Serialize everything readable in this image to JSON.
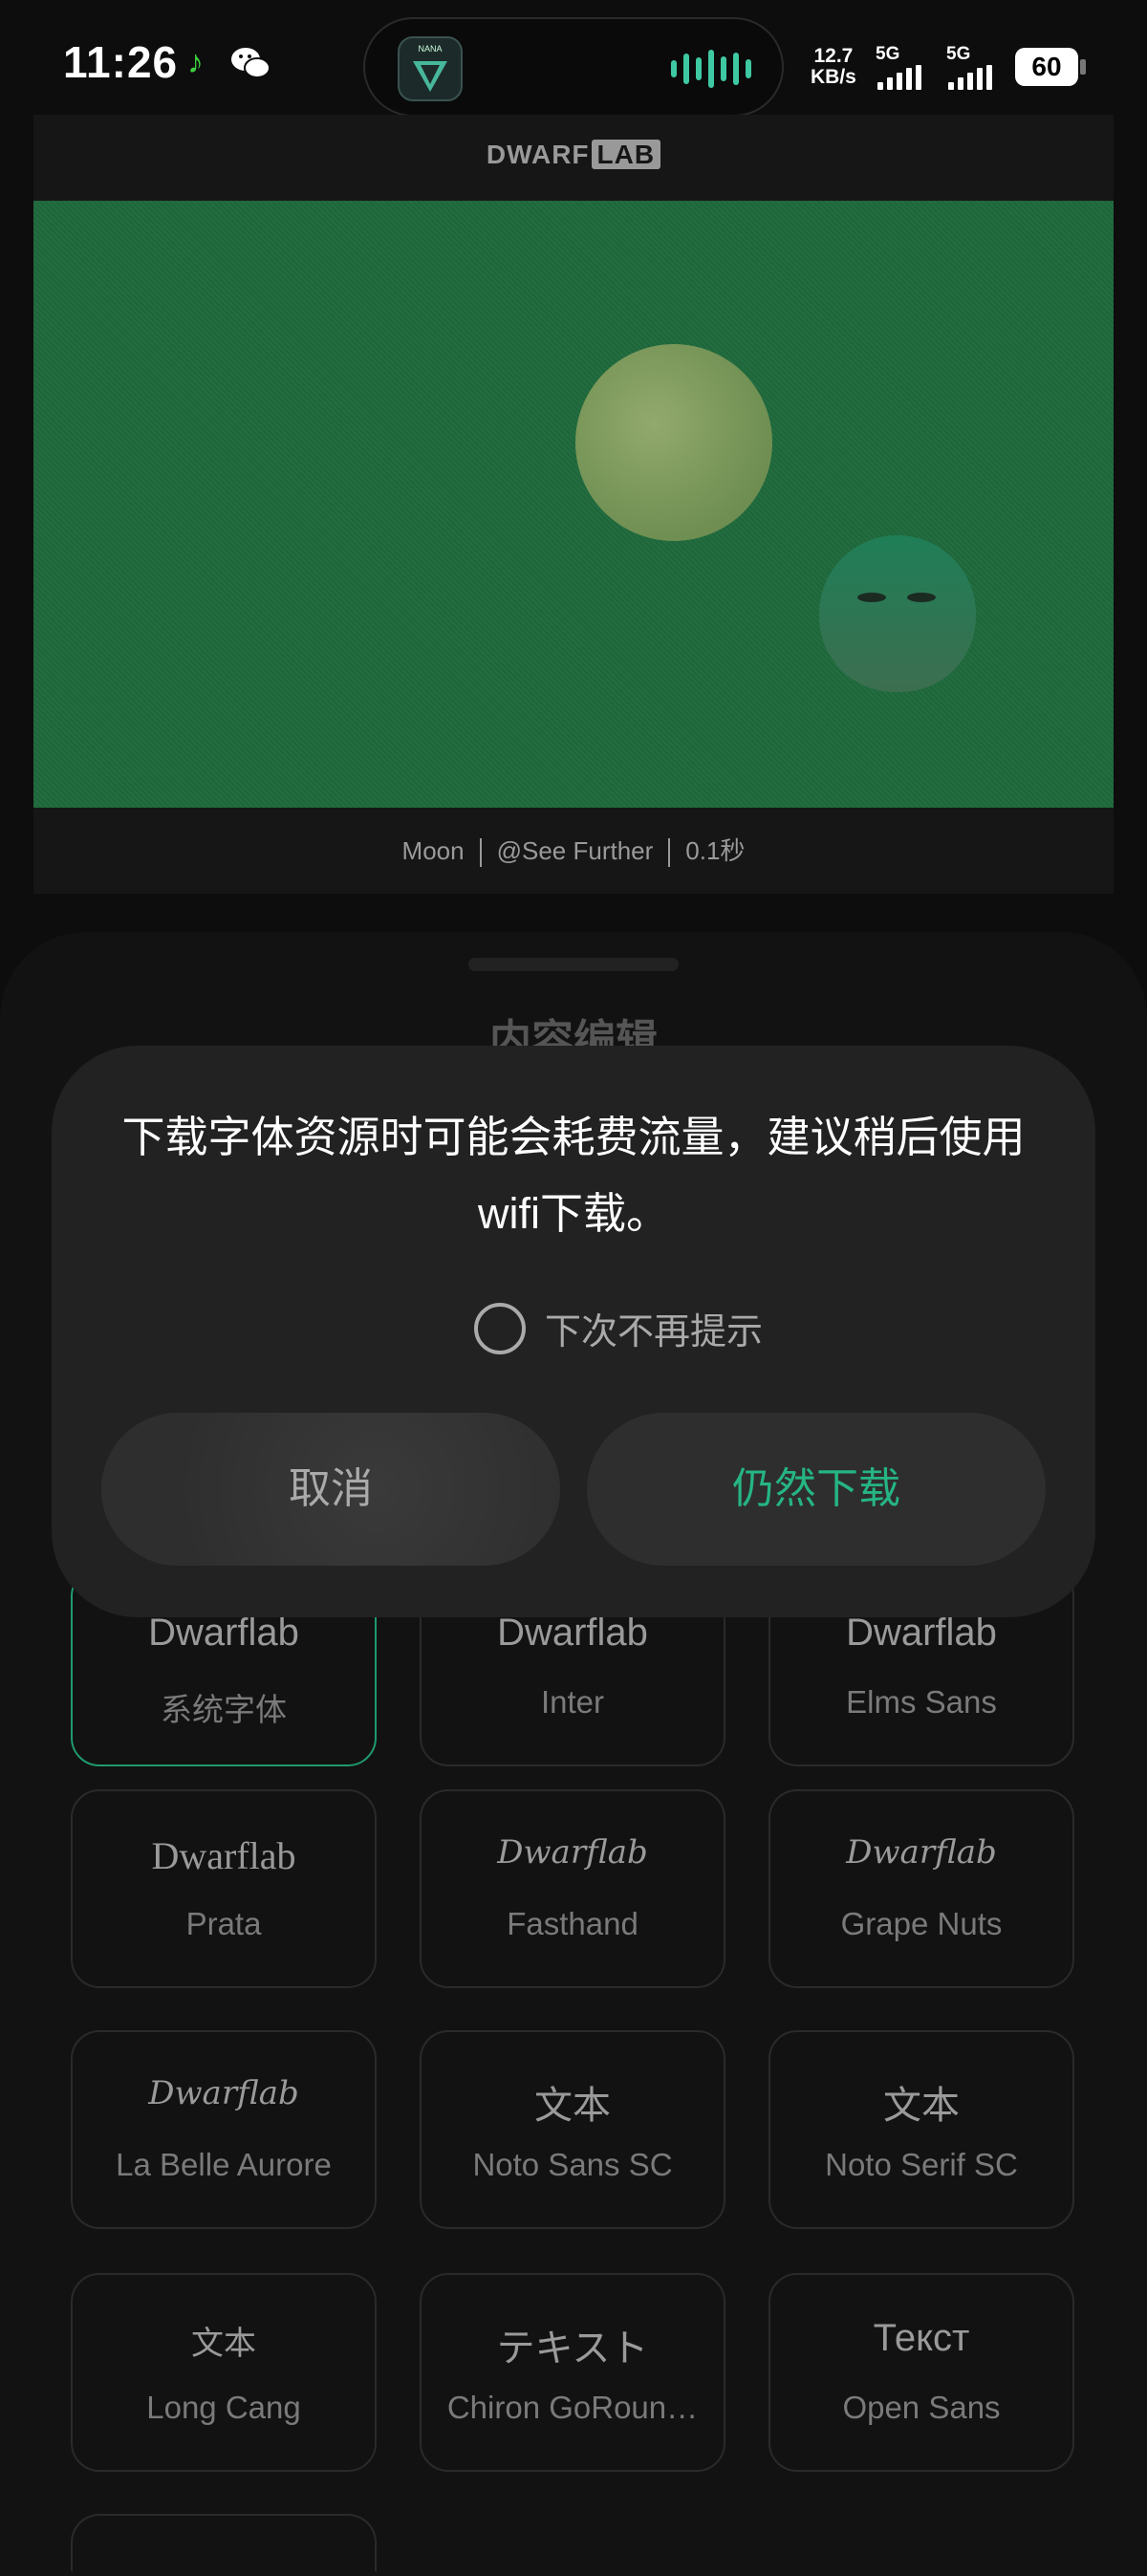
{
  "status_bar": {
    "time": "11:26",
    "app_icons": [
      "music-note-icon",
      "wechat-icon"
    ],
    "island_logo_text": "NANA",
    "net_speed_value": "12.7",
    "net_speed_unit": "KB/s",
    "sim1_label": "5G",
    "sim2_label": "5G",
    "battery": "60",
    "accent_color": "#3fc9a2"
  },
  "preview": {
    "brand_left": "DWARF",
    "brand_right": "LAB",
    "caption_subject": "Moon",
    "caption_author": "@See Further",
    "caption_exposure": "0.1秒",
    "photo_color": "#1f6a3c"
  },
  "sheet": {
    "title": "内容编辑"
  },
  "fonts": [
    {
      "sample": "Dwarflab",
      "name": "系统字体",
      "selected": true
    },
    {
      "sample": "Dwarflab",
      "name": "Inter"
    },
    {
      "sample": "Dwarflab",
      "name": "Elms Sans"
    },
    {
      "sample": "Dwarflab",
      "name": "Prata"
    },
    {
      "sample": "Dwarflab",
      "name": "Fasthand"
    },
    {
      "sample": "Dwarflab",
      "name": "Grape Nuts"
    },
    {
      "sample": "Dwarflab",
      "name": "La Belle Aurore"
    },
    {
      "sample": "文本",
      "name": "Noto Sans SC"
    },
    {
      "sample": "文本",
      "name": "Noto Serif SC"
    },
    {
      "sample": "文本",
      "name": "Long Cang"
    },
    {
      "sample": "テキスト",
      "name": "Chiron GoRoun…"
    },
    {
      "sample": "Текст",
      "name": "Open Sans"
    }
  ],
  "dialog": {
    "message_line1": "下载字体资源时可能会耗费流量，建议稍后使用",
    "message_line2": "wifi下载。",
    "checkbox_label": "下次不再提示",
    "cancel_label": "取消",
    "confirm_label": "仍然下载",
    "confirm_color": "#25b583"
  }
}
